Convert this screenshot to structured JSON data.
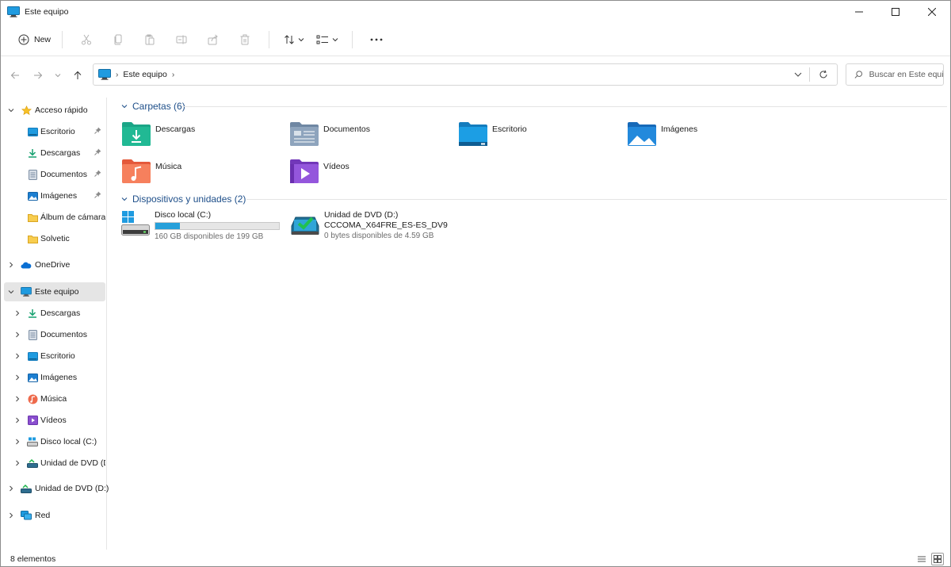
{
  "window": {
    "title": "Este equipo",
    "controls": [
      "minimize",
      "maximize",
      "close"
    ]
  },
  "toolbar": {
    "new_label": "New",
    "icons": [
      "cut-icon",
      "copy-icon",
      "paste-icon",
      "rename-icon",
      "share-icon",
      "delete-icon",
      "sort-icon",
      "view-icon",
      "more-icon"
    ]
  },
  "address": {
    "crumb": "Este equipo",
    "search_placeholder": "Buscar en Este equipo"
  },
  "sidebar": {
    "quick_access": {
      "label": "Acceso rápido",
      "items": [
        {
          "label": "Escritorio",
          "icon": "desktop-icon",
          "pinned": true
        },
        {
          "label": "Descargas",
          "icon": "download-icon",
          "pinned": true
        },
        {
          "label": "Documentos",
          "icon": "documents-icon",
          "pinned": true
        },
        {
          "label": "Imágenes",
          "icon": "pictures-icon",
          "pinned": true
        },
        {
          "label": "Álbum de cámara",
          "icon": "folder-icon",
          "pinned": false
        },
        {
          "label": "Solvetic",
          "icon": "folder-icon",
          "pinned": false
        }
      ]
    },
    "onedrive": {
      "label": "OneDrive"
    },
    "this_pc": {
      "label": "Este equipo",
      "items": [
        {
          "label": "Descargas",
          "icon": "download-icon"
        },
        {
          "label": "Documentos",
          "icon": "documents-icon"
        },
        {
          "label": "Escritorio",
          "icon": "desktop-icon"
        },
        {
          "label": "Imágenes",
          "icon": "pictures-icon"
        },
        {
          "label": "Música",
          "icon": "music-icon"
        },
        {
          "label": "Vídeos",
          "icon": "videos-icon"
        },
        {
          "label": "Disco local (C:)",
          "icon": "drive-icon"
        },
        {
          "label": "Unidad de DVD (D:",
          "icon": "dvd-icon"
        }
      ]
    },
    "dvd_drive": {
      "label": "Unidad de DVD (D:)"
    },
    "network": {
      "label": "Red"
    }
  },
  "content": {
    "folders_header": "Carpetas (6)",
    "folders": [
      {
        "label": "Descargas",
        "icon": "download-folder-icon",
        "color": "#1ba587"
      },
      {
        "label": "Documentos",
        "icon": "documents-folder-icon",
        "color": "#7a93ad"
      },
      {
        "label": "Escritorio",
        "icon": "desktop-folder-icon",
        "color": "#1c94d6"
      },
      {
        "label": "Imágenes",
        "icon": "pictures-folder-icon",
        "color": "#2288d8"
      },
      {
        "label": "Música",
        "icon": "music-folder-icon",
        "color": "#f06a4e"
      },
      {
        "label": "Vídeos",
        "icon": "videos-folder-icon",
        "color": "#8b4fcf"
      }
    ],
    "devices_header": "Dispositivos y unidades (2)",
    "drives": [
      {
        "name": "Disco local (C:)",
        "free": "160 GB disponibles de 199 GB",
        "used_fraction": 0.196
      },
      {
        "name": "Unidad de DVD (D:)",
        "label": "CCCOMA_X64FRE_ES-ES_DV9",
        "free": "0 bytes disponibles de 4.59 GB"
      }
    ]
  },
  "status": {
    "count": "8 elementos"
  },
  "colors": {
    "accent": "#1d4e89",
    "selection": "#e5e5e5",
    "drive_bar": "#26a0da"
  }
}
